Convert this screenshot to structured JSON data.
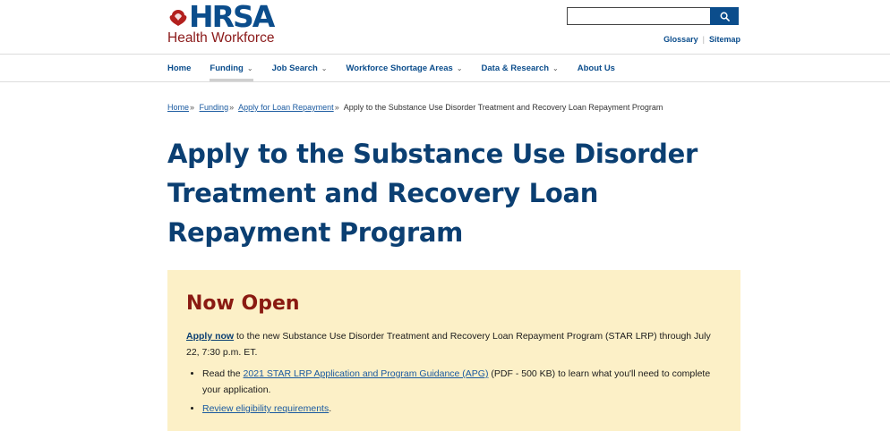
{
  "colors": {
    "brand_blue": "#0b4d8c",
    "title_blue": "#0b3f72",
    "alert_bg": "#fcf0c7",
    "alert_heading": "#8a1a12",
    "brand_red": "#8b1a1a"
  },
  "header": {
    "logo_text": "HRSA",
    "logo_subtext": "Health Workforce",
    "search": {
      "placeholder": "",
      "button_icon": "search-icon"
    },
    "utility_links": [
      "Glossary",
      "Sitemap"
    ]
  },
  "nav": {
    "items": [
      {
        "label": "Home",
        "dropdown": false
      },
      {
        "label": "Funding",
        "dropdown": true
      },
      {
        "label": "Job Search",
        "dropdown": true
      },
      {
        "label": "Workforce Shortage Areas",
        "dropdown": true
      },
      {
        "label": "Data & Research",
        "dropdown": true
      },
      {
        "label": "About Us",
        "dropdown": false
      }
    ]
  },
  "breadcrumb": {
    "links": [
      "Home",
      "Funding",
      "Apply for Loan Repayment"
    ],
    "current": "Apply to the Substance Use Disorder Treatment and Recovery Loan Repayment Program",
    "separator": "»"
  },
  "page": {
    "title": "Apply to the Substance Use Disorder Treatment and Recovery Loan Repayment Program"
  },
  "alert": {
    "heading": "Now Open",
    "para_link": "Apply now",
    "para_text": " to the new Substance Use Disorder Treatment and Recovery Loan Repayment Program (STAR LRP) through July 22, 7:30 p.m. ET.",
    "bullets": [
      {
        "prefix": "Read the ",
        "link": "2021 STAR LRP Application and Program Guidance (APG)",
        "suffix": " (PDF - 500 KB) to learn what you'll need to complete your application."
      },
      {
        "prefix": "",
        "link": "Review eligibility requirements",
        "suffix": "."
      }
    ]
  }
}
